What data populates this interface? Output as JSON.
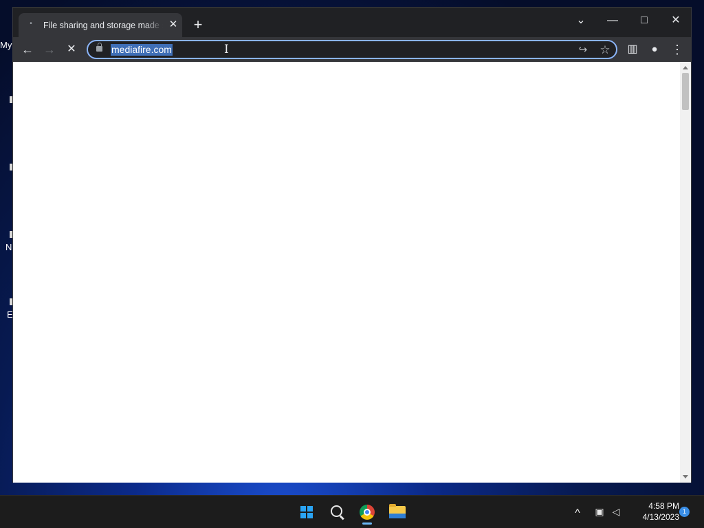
{
  "desktop": {
    "fragments": [
      "My",
      "N",
      "E"
    ]
  },
  "browser": {
    "tab": {
      "title": "File sharing and storage made simple",
      "favicon": "loading-dot-icon"
    },
    "toolbar": {
      "url": "mediafire.com",
      "back_icon": "←",
      "forward_icon": "→",
      "stop_icon": "✕",
      "share_icon": "↪",
      "bookmark_icon": "☆",
      "sidepanel_icon": "▥",
      "profile_icon": "●",
      "menu_icon": "⋮",
      "newtab_icon": "+",
      "tab_close_icon": "✕"
    },
    "window_controls": {
      "tabsearch": "⌄",
      "minimize": "—",
      "maximize": "□",
      "close": "✕"
    }
  },
  "taskbar": {
    "clock": {
      "time": "4:58 PM",
      "date": "4/13/2023"
    },
    "notification_count": "1",
    "tray": {
      "chevron": "^",
      "network": "▣",
      "volume": "◁"
    }
  },
  "colors": {
    "accent": "#8ab4f8",
    "url_selection": "#3f6fb7",
    "windows_blue": "#2aa4f4"
  }
}
